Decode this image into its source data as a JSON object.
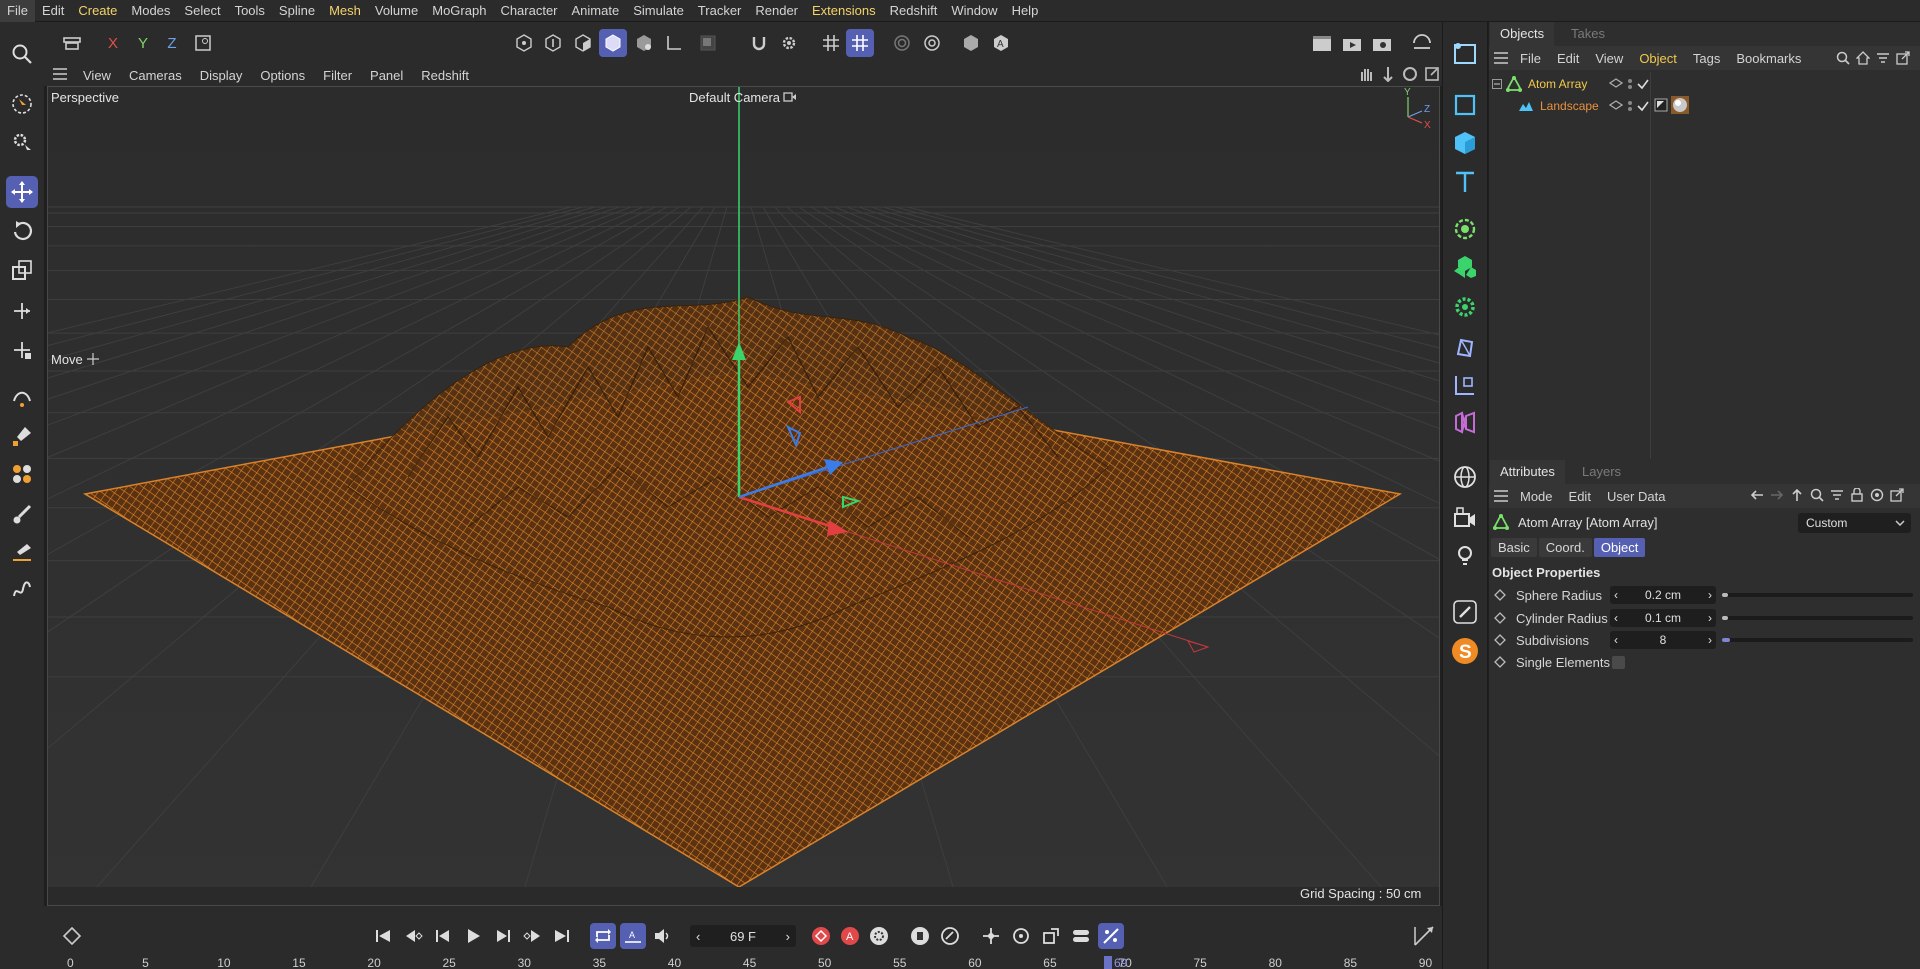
{
  "menubar": {
    "items": [
      "File",
      "Edit",
      "Create",
      "Modes",
      "Select",
      "Tools",
      "Spline",
      "Mesh",
      "Volume",
      "MoGraph",
      "Character",
      "Animate",
      "Simulate",
      "Tracker",
      "Render",
      "Extensions",
      "Redshift",
      "Window",
      "Help"
    ]
  },
  "toolbar": {
    "axis_x": "X",
    "axis_y": "Y",
    "axis_z": "Z"
  },
  "viewport": {
    "menu": [
      "View",
      "Cameras",
      "Display",
      "Options",
      "Filter",
      "Panel",
      "Redshift"
    ],
    "projection": "Perspective",
    "camera": "Default Camera",
    "tool_label": "Move",
    "grid_spacing": "Grid Spacing : 50 cm",
    "axis_labels": {
      "y": "Y",
      "z": "Z",
      "x": "X"
    }
  },
  "objects_panel": {
    "tabs": [
      "Objects",
      "Takes"
    ],
    "menu": [
      "File",
      "Edit",
      "View",
      "Object",
      "Tags",
      "Bookmarks"
    ],
    "tree": [
      {
        "name": "Atom Array",
        "color": "#f2c94c"
      },
      {
        "name": "Landscape",
        "color": "#e8913f"
      }
    ]
  },
  "attributes_panel": {
    "tabs": [
      "Attributes",
      "Layers"
    ],
    "menu": [
      "Mode",
      "Edit",
      "User Data"
    ],
    "object_title": "Atom Array [Atom Array]",
    "preset": "Custom",
    "subtabs": [
      "Basic",
      "Coord.",
      "Object"
    ],
    "section": "Object Properties",
    "properties": [
      {
        "label": "Sphere Radius",
        "value": "0.2 cm",
        "fill": 0.02
      },
      {
        "label": "Cylinder Radius",
        "value": "0.1 cm",
        "fill": 0.01
      },
      {
        "label": "Subdivisions",
        "value": "8",
        "fill": 0.04
      },
      {
        "label": "Single Elements"
      }
    ]
  },
  "timeline": {
    "frame": "69 F",
    "current_frame": "69",
    "ruler": [
      "0",
      "5",
      "10",
      "15",
      "20",
      "25",
      "30",
      "35",
      "40",
      "45",
      "50",
      "55",
      "60",
      "65",
      "70",
      "75",
      "80",
      "85",
      "90"
    ]
  },
  "colors": {
    "accent": "#5660b3",
    "mesh": "#d9822b",
    "selected_object": "#f2c94c"
  }
}
